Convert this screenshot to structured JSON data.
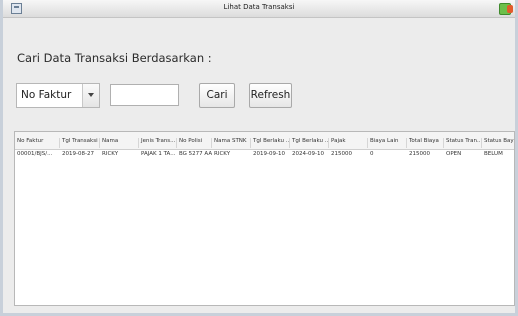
{
  "window": {
    "title": "Lihat Data Transaksi"
  },
  "search": {
    "heading": "Cari Data Transaksi Berdasarkan :",
    "selected_criteria": "No Faktur",
    "input_value": "",
    "cari_label": "Cari",
    "refresh_label": "Refresh"
  },
  "table": {
    "columns": [
      "No Faktur",
      "Tgl Transaksi",
      "Nama",
      "Jenis Trans...",
      "No Polisi",
      "Nama STNK",
      "Tgl Berlaku ...",
      "Tgl Berlaku ...",
      "Pajak",
      "Biaya Lain",
      "Total Biaya",
      "Status Tran...",
      "Status Bayar"
    ],
    "rows": [
      [
        "00001/BJS/...",
        "2019-08-27",
        "RICKY",
        "PAJAK 1 TA...",
        "BG 5277 AA",
        "RICKY",
        "2019-09-10",
        "2024-09-10",
        "215000",
        "0",
        "215000",
        "OPEN",
        "BELUM"
      ]
    ]
  },
  "icons": {
    "app": "window-icon",
    "close": "close-icon"
  }
}
